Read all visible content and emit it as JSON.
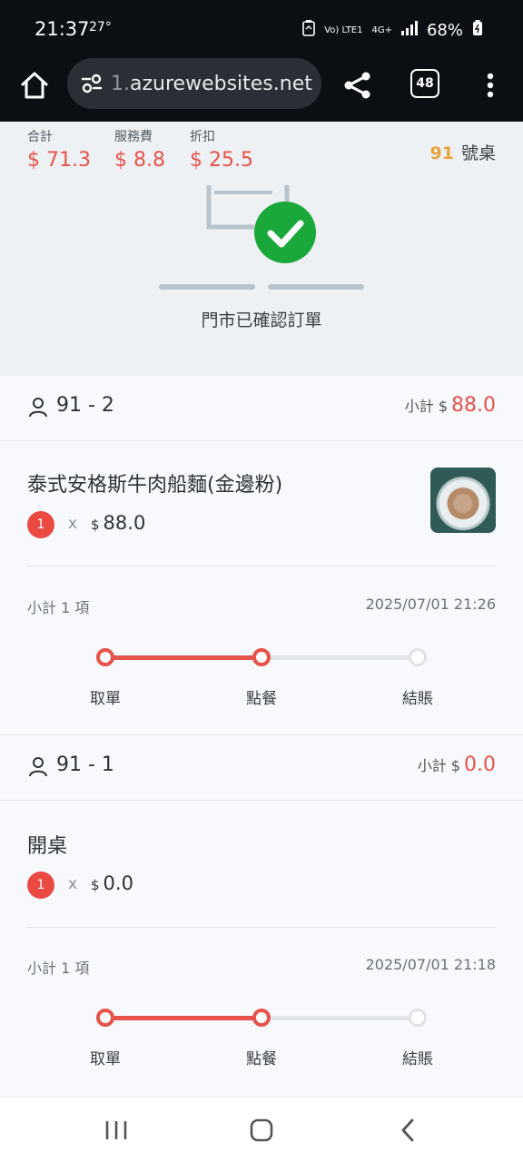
{
  "status_bar": {
    "time": "21:37",
    "temperature": "27°",
    "volte_label": "Vo) LTE1",
    "network": "4G+",
    "battery": "68%"
  },
  "browser": {
    "url_faded": "1.",
    "url": "azurewebsites.net",
    "tab_count": "48"
  },
  "summary": {
    "total_label": "合計",
    "total_value": "$ 71.3",
    "service_label": "服務費",
    "service_value": "$ 8.8",
    "discount_label": "折扣",
    "discount_value": "$ 25.5",
    "table_number": "91",
    "table_suffix": "號桌",
    "confirmed_text": "門市已確認訂單"
  },
  "orders": [
    {
      "seat": "91 - 2",
      "subtotal_label": "小計 $",
      "subtotal_value": "88.0",
      "item_name": "泰式安格斯牛肉船麵(金邊粉)",
      "qty": "1",
      "times": "x",
      "currency": "$",
      "price": "88.0",
      "count_text": "小計 1 項",
      "datetime": "2025/07/01 21:26",
      "steps": [
        "取單",
        "點餐",
        "結賬"
      ],
      "progress_step": 2
    },
    {
      "seat": "91 - 1",
      "subtotal_label": "小計 $",
      "subtotal_value": "0.0",
      "item_name": "開桌",
      "qty": "1",
      "times": "x",
      "currency": "$",
      "price": "0.0",
      "count_text": "小計 1 項",
      "datetime": "2025/07/01 21:18",
      "steps": [
        "取單",
        "點餐",
        "結賬"
      ],
      "progress_step": 2
    }
  ],
  "colors": {
    "accent_red": "#e5534b",
    "table_number_orange": "#e8a23a",
    "confirm_green": "#1aa83a"
  }
}
